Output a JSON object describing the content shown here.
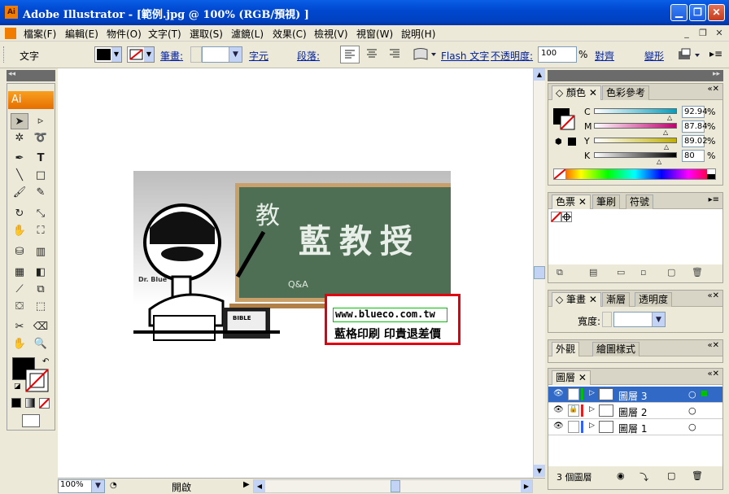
{
  "window": {
    "title": "Adobe Illustrator - [範例.jpg @ 100% (RGB/預視) ]",
    "app_icon": "Ai"
  },
  "menu": {
    "items": [
      "檔案(F)",
      "編輯(E)",
      "物件(O)",
      "文字(T)",
      "選取(S)",
      "濾鏡(L)",
      "效果(C)",
      "檢視(V)",
      "視窗(W)",
      "說明(H)"
    ]
  },
  "control_bar": {
    "mode_label": "文字",
    "stroke_link": "筆畫:",
    "char_link": "字元",
    "para_link": "段落:",
    "flash_link": "Flash 文字",
    "opacity_label": "不透明度:",
    "opacity_value": "100",
    "opacity_unit": "%",
    "align_link": "對齊",
    "transform_link": "變形"
  },
  "toolbox": {
    "logo": "Ai"
  },
  "artwork": {
    "dr_blue": "Dr. Blue",
    "board_title": "藍教授",
    "board_small": "Q&A",
    "book_label": "BIBLE",
    "url_text": "www.blueco.com.tw",
    "slogan": "藍格印刷 印貴退差價"
  },
  "status": {
    "zoom": "100%",
    "state": "開啟"
  },
  "color_panel": {
    "tabs": [
      "顏色",
      "色彩參考"
    ],
    "channels": [
      {
        "label": "C",
        "value": "92.94",
        "unit": "%",
        "level": 0.9294,
        "color": "#00a0c0"
      },
      {
        "label": "M",
        "value": "87.84",
        "unit": "%",
        "level": 0.8784,
        "color": "#c00070"
      },
      {
        "label": "Y",
        "value": "89.02",
        "unit": "%",
        "level": 0.8902,
        "color": "#c0b000"
      },
      {
        "label": "K",
        "value": "80",
        "unit": "%",
        "level": 0.8,
        "color": "#000000"
      }
    ]
  },
  "swatch_panel": {
    "tabs": [
      "色票",
      "筆刷",
      "符號"
    ]
  },
  "stroke_panel": {
    "tabs": [
      "筆畫",
      "漸層",
      "透明度"
    ],
    "weight_label": "寬度:"
  },
  "appearance_panel": {
    "tabs": [
      "外觀",
      "繪圖樣式"
    ]
  },
  "layers_panel": {
    "tabs": [
      "圖層"
    ],
    "layers": [
      {
        "name": "圖層 3",
        "color": "#00c000",
        "locked": false,
        "selected": true
      },
      {
        "name": "圖層 2",
        "color": "#e02020",
        "locked": true,
        "selected": false
      },
      {
        "name": "圖層 1",
        "color": "#3060ff",
        "locked": false,
        "selected": false
      }
    ],
    "count_label": "3 個圖層"
  }
}
